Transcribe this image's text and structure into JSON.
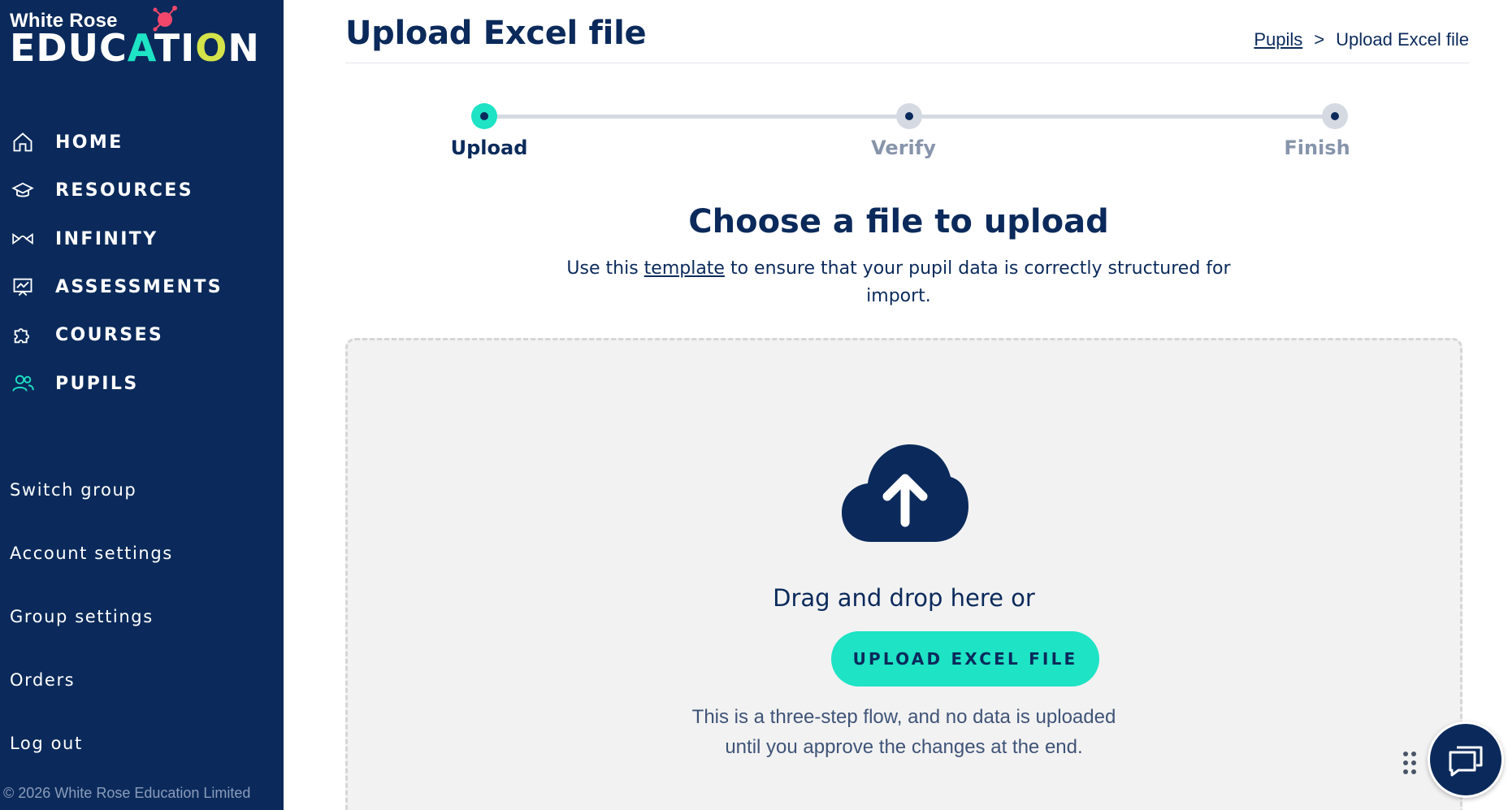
{
  "brand": {
    "line1": "White Rose",
    "line2_a": "EDUC",
    "line2_b": "A",
    "line2_c": "TI",
    "line2_d": "O",
    "line2_e": "N",
    "accent_color": "#1ee3c5",
    "sidebar_color": "#0b2a5b"
  },
  "nav": {
    "items": [
      {
        "label": "HOME",
        "icon": "home-icon"
      },
      {
        "label": "RESOURCES",
        "icon": "graduation-cap-icon"
      },
      {
        "label": "INFINITY",
        "icon": "infinity-icon"
      },
      {
        "label": "ASSESSMENTS",
        "icon": "presentation-chart-icon"
      },
      {
        "label": "COURSES",
        "icon": "puzzle-icon"
      },
      {
        "label": "PUPILS",
        "icon": "users-icon",
        "active": true
      }
    ],
    "secondary": [
      {
        "label": "Switch group"
      },
      {
        "label": "Account settings"
      },
      {
        "label": "Group settings"
      },
      {
        "label": "Orders"
      },
      {
        "label": "Log out"
      }
    ],
    "copyright": "© 2026 White Rose Education Limited"
  },
  "header": {
    "title": "Upload Excel file",
    "breadcrumb": {
      "parent": "Pupils",
      "separator": ">",
      "current": "Upload Excel file"
    }
  },
  "stepper": {
    "steps": [
      {
        "label": "Upload",
        "active": true
      },
      {
        "label": "Verify",
        "active": false
      },
      {
        "label": "Finish",
        "active": false
      }
    ]
  },
  "upload": {
    "title": "Choose a file to upload",
    "desc_before": "Use this ",
    "desc_link": "template",
    "desc_after": " to ensure that your pupil data is correctly structured for import.",
    "drag_text": "Drag and drop here or",
    "button_label": "UPLOAD EXCEL FILE",
    "info": "This is a three-step flow, and no data is uploaded until you approve the changes at the end."
  },
  "widgets": {
    "chat_icon": "chat-icon",
    "drag_icon": "drag-handle-icon"
  }
}
